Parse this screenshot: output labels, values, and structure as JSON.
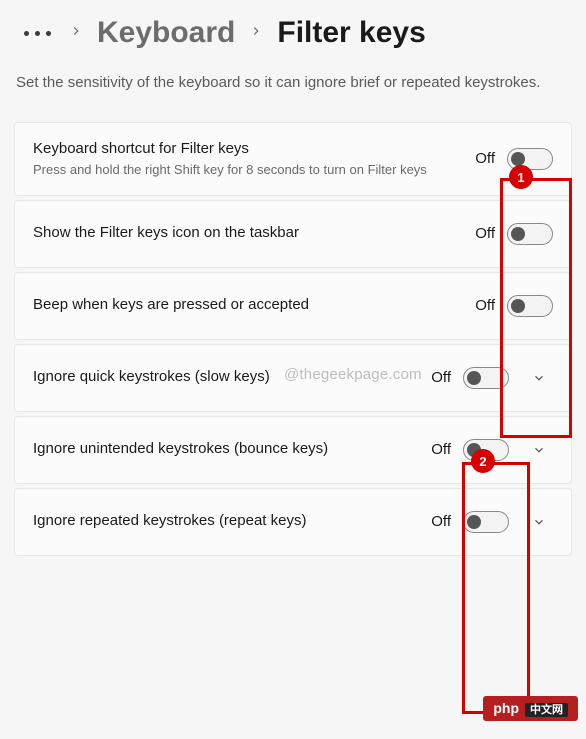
{
  "breadcrumb": {
    "parent": "Keyboard",
    "current": "Filter keys"
  },
  "description": "Set the sensitivity of the keyboard so it can ignore brief or repeated keystrokes.",
  "settings": [
    {
      "title": "Keyboard shortcut for Filter keys",
      "sub": "Press and hold the right Shift key for 8 seconds to turn on Filter keys",
      "state": "Off",
      "expandable": false
    },
    {
      "title": "Show the Filter keys icon on the taskbar",
      "sub": "",
      "state": "Off",
      "expandable": false
    },
    {
      "title": "Beep when keys are pressed or accepted",
      "sub": "",
      "state": "Off",
      "expandable": false
    },
    {
      "title": "Ignore quick keystrokes (slow keys)",
      "sub": "",
      "state": "Off",
      "expandable": true
    },
    {
      "title": "Ignore unintended keystrokes (bounce keys)",
      "sub": "",
      "state": "Off",
      "expandable": true
    },
    {
      "title": "Ignore repeated keystrokes (repeat keys)",
      "sub": "",
      "state": "Off",
      "expandable": true
    }
  ],
  "annotations": {
    "label1": "1",
    "label2": "2"
  },
  "watermark": "@thegeekpage.com",
  "phpTag": {
    "text": "php",
    "cn": "中文网"
  }
}
